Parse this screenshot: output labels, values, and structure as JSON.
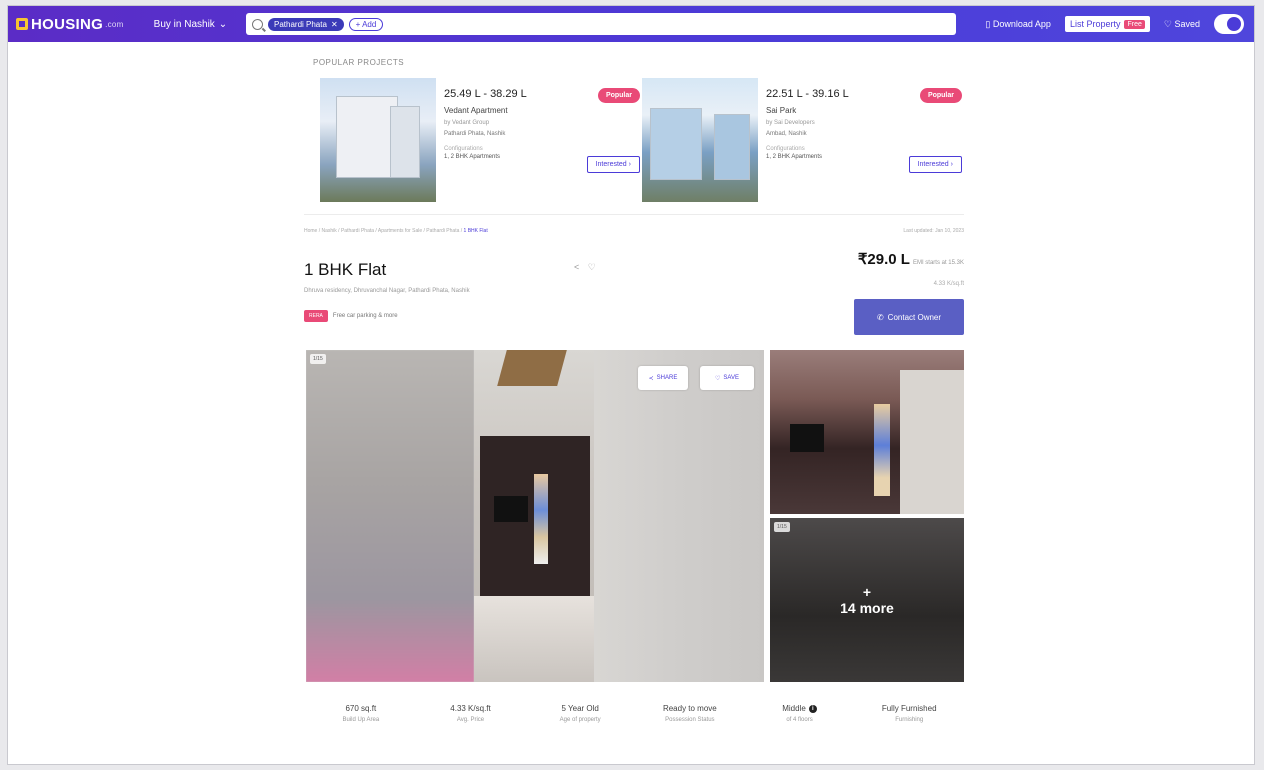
{
  "topbar": {
    "logo_text": "HOUSING",
    "logo_suffix": ".com",
    "buy_dropdown": "Buy in Nashik",
    "chip": "Pathardi Phata",
    "add_more": "+ Add",
    "download_app": "Download App",
    "list_property": "List Property",
    "free_badge": "Free",
    "saved": "Saved"
  },
  "popular_projects": {
    "title": "POPULAR PROJECTS",
    "cards": [
      {
        "price": "25.49 L - 38.29 L",
        "name": "Vedant Apartment",
        "developer": "by Vedant Group",
        "location": "Pathardi Phata, Nashik",
        "config_label": "Configurations",
        "config_value": "1, 2 BHK Apartments",
        "badge": "Popular",
        "cta": "Interested"
      },
      {
        "price": "22.51 L - 39.16 L",
        "name": "Sai Park",
        "developer": "by Sai Developers",
        "location": "Ambad, Nashik",
        "config_label": "Configurations",
        "config_value": "1, 2 BHK Apartments",
        "badge": "Popular",
        "cta": "Interested"
      }
    ]
  },
  "breadcrumb": {
    "path": "Home / Nashik / Pathardi Phata / Apartments for Sale / Pathardi Phata / ",
    "current": "1 BHK Flat",
    "last_updated": "Last updated: Jan 10, 2023"
  },
  "listing": {
    "title": "1 BHK Flat",
    "share_icons": "< ♡",
    "address": "Dhruva residency, Dhruvanchal Nagar, Pathardi Phata, Nashik",
    "rera_tag": "RERA",
    "rera_text": "Free car parking & more",
    "price": "₹29.0 L",
    "price_emi": "EMI starts at 15.3K",
    "price_note": "4.33 K/sq.ft",
    "contact_button": "Contact Owner"
  },
  "gallery": {
    "main_badge": "1/15",
    "share_label": "SHARE",
    "save_label": "SAVE",
    "thumb_badge": "1/15",
    "more_plus": "+",
    "more_label": "14 more"
  },
  "stats": [
    {
      "value": "670 sq.ft",
      "label": "Build Up Area"
    },
    {
      "value": "4.33 K/sq.ft",
      "label": "Avg. Price"
    },
    {
      "value": "5 Year Old",
      "label": "Age of property"
    },
    {
      "value": "Ready to move",
      "label": "Possession Status"
    },
    {
      "value": "Middle",
      "label": "of 4 floors",
      "info": "i"
    },
    {
      "value": "Fully Furnished",
      "label": "Furnishing"
    }
  ]
}
